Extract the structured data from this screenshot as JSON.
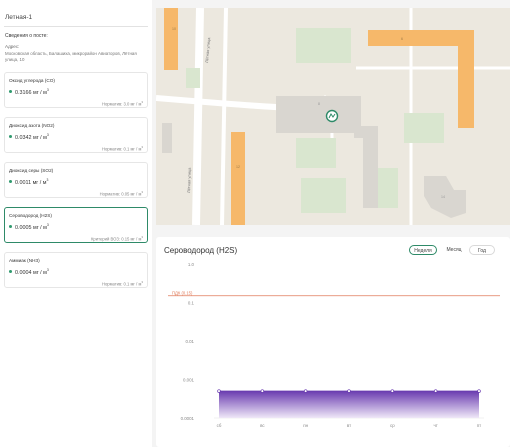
{
  "post": {
    "title": "Летная-1",
    "info_heading": "Сведения о посте:",
    "address_label": "Адрес:",
    "address_text": "Московская область, Балашиха, микрорайон Авиаторов, Лётная улица, 10"
  },
  "substances": [
    {
      "name": "Оксид углерода (CO)",
      "value": "0.3166 мг / м",
      "unit_exp": "3",
      "norm_label": "Норматив: 3.0 мг / м",
      "norm_exp": "3",
      "active": false
    },
    {
      "name": "Диоксид азота (NO2)",
      "value": "0.0342 мг / м",
      "unit_exp": "3",
      "norm_label": "Норматив: 0.1 мг / м",
      "norm_exp": "3",
      "active": false
    },
    {
      "name": "Диоксид серы (SO2)",
      "value": "0.0011 мг / м",
      "unit_exp": "3",
      "norm_label": "Норматив: 0.05 мг / м",
      "norm_exp": "3",
      "active": false
    },
    {
      "name": "Сероводород (H2S)",
      "value": "0.0005 мг / м",
      "unit_exp": "3",
      "norm_label": "Критерий ВОЗ: 0.15 мг / м",
      "norm_exp": "3",
      "active": true
    },
    {
      "name": "Аммиак (NH3)",
      "value": "0.0004 мг / м",
      "unit_exp": "3",
      "norm_label": "Норматив: 0.1 мг / м",
      "norm_exp": "3",
      "active": false
    }
  ],
  "map": {
    "street_labels": [
      "Лётная улица",
      "Лётная улица"
    ],
    "building_numbers": [
      "10",
      "6",
      "8",
      "12",
      "14"
    ],
    "colors": {
      "background": "#e9e5dc",
      "residential": "#f6b86a",
      "grass": "#d9e6cf",
      "building": "#d9d6d0",
      "marker": "#2e8a68"
    }
  },
  "chart": {
    "title": "Сероводород (H2S)",
    "periods": [
      {
        "label": "Неделя",
        "active": true
      },
      {
        "label": "Месяц",
        "active": false
      },
      {
        "label": "Год",
        "active": false
      }
    ]
  },
  "chart_data": {
    "type": "area",
    "title": "Сероводород (H2S)",
    "x": [
      "сб",
      "вс",
      "пн",
      "вт",
      "ср",
      "чт",
      "пт"
    ],
    "series": [
      {
        "values": [
          0.0005,
          0.0005,
          0.0005,
          0.0005,
          0.0005,
          0.0005,
          0.0005
        ]
      }
    ],
    "y_scale": "log",
    "y_ticks": [
      "1.0",
      "0.1",
      "0.01",
      "0.001",
      "0.0001"
    ],
    "ylim": [
      0.0001,
      1.0
    ],
    "reference_line": {
      "label": "ПДК (0.15)",
      "value": 0.15
    },
    "colors": {
      "area_top": "#6a3cb0",
      "area_bottom": "#efe8f8",
      "reference": "#e07b5a"
    },
    "grid": false
  }
}
